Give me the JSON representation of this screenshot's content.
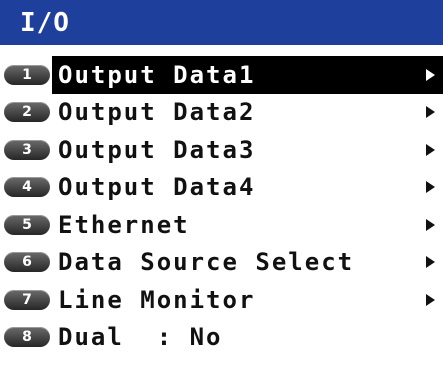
{
  "header": {
    "title": "I/O",
    "background_color": "#1f3f9d"
  },
  "menu": {
    "selected_index": 0,
    "items": [
      {
        "key": "1",
        "label": "Output Data1",
        "has_submenu": true
      },
      {
        "key": "2",
        "label": "Output Data2",
        "has_submenu": true
      },
      {
        "key": "3",
        "label": "Output Data3",
        "has_submenu": true
      },
      {
        "key": "4",
        "label": "Output Data4",
        "has_submenu": true
      },
      {
        "key": "5",
        "label": "Ethernet",
        "has_submenu": true
      },
      {
        "key": "6",
        "label": "Data Source Select",
        "has_submenu": true
      },
      {
        "key": "7",
        "label": "Line Monitor",
        "has_submenu": true
      },
      {
        "key": "8",
        "label": "Dual  : No",
        "has_submenu": false
      }
    ]
  },
  "icons": {
    "submenu": "triangle-right-icon"
  }
}
